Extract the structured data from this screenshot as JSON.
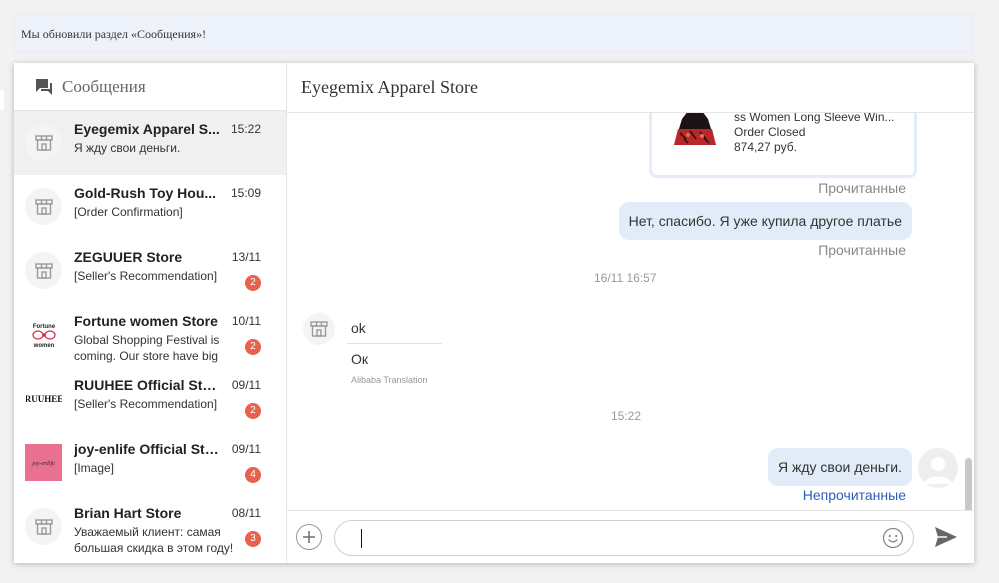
{
  "notice": {
    "text": "Мы обновили раздел «Сообщения»!"
  },
  "sidebar": {
    "title": "Сообщения",
    "conversations": [
      {
        "name": "Eyegemix Apparel S...",
        "time": "15:22",
        "preview": "Я жду свои деньги.",
        "badge": "",
        "active": true
      },
      {
        "name": "Gold-Rush Toy Hou...",
        "time": "15:09",
        "preview": "[Order Confirmation]",
        "badge": ""
      },
      {
        "name": "ZEGUUER Store",
        "time": "13/11",
        "preview": "[Seller's Recommendation]",
        "badge": "2"
      },
      {
        "name": "Fortune women Store",
        "time": "10/11",
        "preview": "Global Shopping Festival is coming. Our store have big Disc...",
        "badge": "2",
        "avatar_text": "Fortune women"
      },
      {
        "name": "RUUHEE Official Store",
        "time": "09/11",
        "preview": "[Seller's Recommendation]",
        "badge": "2",
        "avatar_text": "RUUHEE"
      },
      {
        "name": "joy-enlife Official Store",
        "time": "09/11",
        "preview": "[Image]",
        "badge": "4",
        "avatar_text": "joy-enlife"
      },
      {
        "name": "Brian Hart Store",
        "time": "08/11",
        "preview": "Уважаемый клиент: самая большая скидка в этом году! До...",
        "badge": "3"
      }
    ]
  },
  "chat": {
    "title": "Eyegemix Apparel Store",
    "order_card": {
      "line1": "ss Women Long Sleeve Win...",
      "line2": "Order Closed",
      "line3": "874,27 руб."
    },
    "read_status_1": "Прочитанные",
    "message_out_1": "Нет, спасибо. Я уже купила другое платье",
    "read_status_2": "Прочитанные",
    "datestamp_1": "16/11 16:57",
    "incoming": {
      "original": "ok",
      "translated": "Ок",
      "translation_label": "Alibaba Translation"
    },
    "datestamp_2": "15:22",
    "message_out_2": "Я жду свои деньги.",
    "unread_status": "Непрочитанные"
  },
  "composer": {
    "value": ""
  },
  "colors": {
    "accent_unread": "#2b5db8",
    "badge": "#e9614f",
    "bubble_out": "#e2ecf8"
  }
}
